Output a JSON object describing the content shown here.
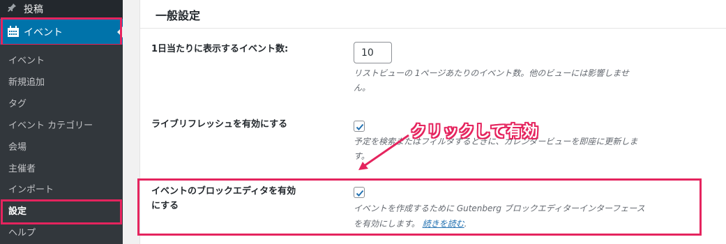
{
  "sidebar": {
    "posts_label": "投稿",
    "events_label": "イベント",
    "submenu": [
      "イベント",
      "新規追加",
      "タグ",
      "イベント カテゴリー",
      "会場",
      "主催者",
      "インポート",
      "設定",
      "ヘルプ"
    ]
  },
  "main": {
    "section_title": "一般設定",
    "events_per_page": {
      "label": "1日当たりに表示するイベント数:",
      "value": "10",
      "description_line1": "リストビューの 1ページあたりのイベント数。他のビューには影響しませ",
      "description_line2": "ん。"
    },
    "live_refresh": {
      "label": "ライブリフレッシュを有効にする",
      "checked": true,
      "description_line1": "予定を検索またはフィルタするときに、カレンダービューを即座に更新しま",
      "description_line2": "す。"
    },
    "block_editor": {
      "label_line1": "イベントのブロックエディタを有効",
      "label_line2": "にする",
      "checked": true,
      "description_line1": "イベントを作成するために Gutenberg ブロックエディターインターフェース",
      "description_line2_prefix": "を有効にします。",
      "read_more": "続きを読む",
      "description_line2_suffix": "."
    }
  },
  "annotation": {
    "callout": "クリックして有効",
    "color": "#e5245e"
  },
  "colors": {
    "sidebar_bg": "#23282d",
    "submenu_bg": "#32373c",
    "active_menu": "#0073aa",
    "checkbox_check": "#2271b1"
  }
}
